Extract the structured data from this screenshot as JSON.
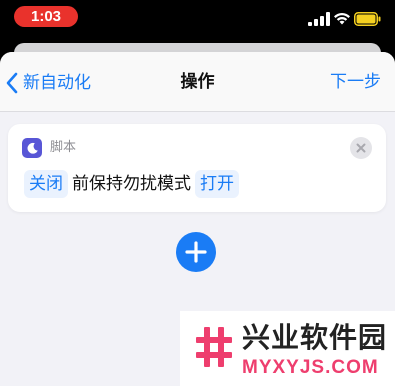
{
  "status_bar": {
    "time": "1:03",
    "icons": [
      "cellular-signal-icon",
      "wifi-icon",
      "battery-icon"
    ],
    "time_pill_color": "#e9322c",
    "battery_color": "#f5d020"
  },
  "nav": {
    "back_label": "新自动化",
    "title": "操作",
    "next_label": "下一步",
    "accent": "#1a7cf5"
  },
  "action_card": {
    "icon": "moon-icon",
    "icon_color": "#5856d6",
    "type_label": "脚本",
    "toggle_token": "关闭",
    "body_text": "前保持勿扰模式",
    "state_token": "打开"
  },
  "add_button": {
    "icon": "plus-icon"
  },
  "watermark": {
    "logo": "hash-logo-icon",
    "name_cn": "兴业软件园",
    "name_en": "MYXYJS.COM",
    "brand_color": "#ee3e6e"
  }
}
